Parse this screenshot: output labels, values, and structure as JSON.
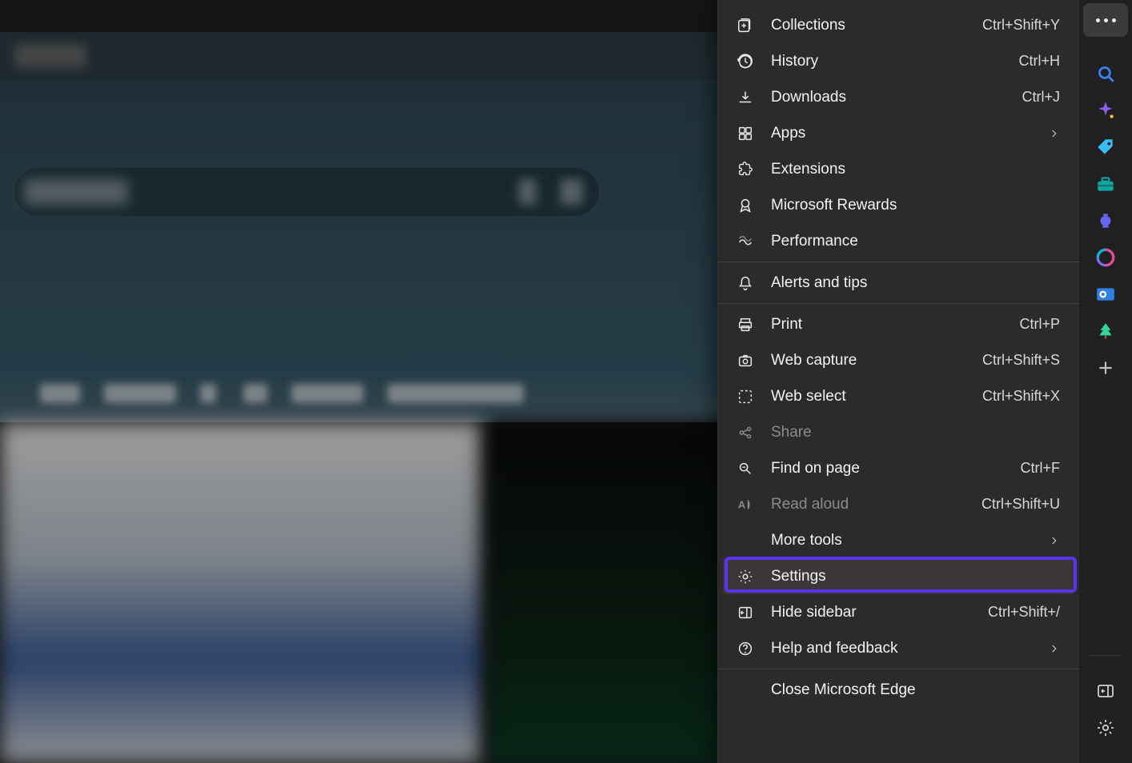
{
  "menu": {
    "items": [
      {
        "icon": "collections",
        "label": "Collections",
        "shortcut": "Ctrl+Shift+Y"
      },
      {
        "icon": "history",
        "label": "History",
        "shortcut": "Ctrl+H"
      },
      {
        "icon": "downloads",
        "label": "Downloads",
        "shortcut": "Ctrl+J"
      },
      {
        "icon": "apps",
        "label": "Apps",
        "chevron": true
      },
      {
        "icon": "extensions",
        "label": "Extensions"
      },
      {
        "icon": "rewards",
        "label": "Microsoft Rewards"
      },
      {
        "icon": "performance",
        "label": "Performance"
      },
      {
        "sep": true
      },
      {
        "icon": "alerts",
        "label": "Alerts and tips"
      },
      {
        "sep": true
      },
      {
        "icon": "print",
        "label": "Print",
        "shortcut": "Ctrl+P"
      },
      {
        "icon": "webcapture",
        "label": "Web capture",
        "shortcut": "Ctrl+Shift+S"
      },
      {
        "icon": "webselect",
        "label": "Web select",
        "shortcut": "Ctrl+Shift+X"
      },
      {
        "icon": "share",
        "label": "Share",
        "disabled": true
      },
      {
        "icon": "find",
        "label": "Find on page",
        "shortcut": "Ctrl+F"
      },
      {
        "icon": "readaloud",
        "label": "Read aloud",
        "shortcut": "Ctrl+Shift+U",
        "disabled": true
      },
      {
        "icon": "none",
        "label": "More tools",
        "chevron": true,
        "noIcon": true
      },
      {
        "icon": "settings",
        "label": "Settings",
        "hovered": true,
        "highlight": true
      },
      {
        "icon": "hidesidebar",
        "label": "Hide sidebar",
        "shortcut": "Ctrl+Shift+/"
      },
      {
        "icon": "help",
        "label": "Help and feedback",
        "chevron": true
      },
      {
        "sep": true
      },
      {
        "icon": "none",
        "label": "Close Microsoft Edge",
        "noIcon": true
      }
    ]
  },
  "sidebar": {
    "icons": [
      {
        "name": "search",
        "color": "#3b82f6"
      },
      {
        "name": "sparkle",
        "color": "#8b5cf6"
      },
      {
        "name": "tag",
        "color": "#38bdf8"
      },
      {
        "name": "toolbox",
        "color": "#0ea5a3"
      },
      {
        "name": "chess",
        "color": "#6366f1"
      },
      {
        "name": "office",
        "color": "#7c6df0"
      },
      {
        "name": "outlook",
        "color": "#2f7fe6"
      },
      {
        "name": "tree",
        "color": "#34d399"
      },
      {
        "name": "plus",
        "color": "#bfbfbf"
      }
    ],
    "bottom": [
      {
        "name": "panel",
        "color": "#d0d0d0"
      },
      {
        "name": "gear",
        "color": "#d0d0d0"
      }
    ]
  }
}
